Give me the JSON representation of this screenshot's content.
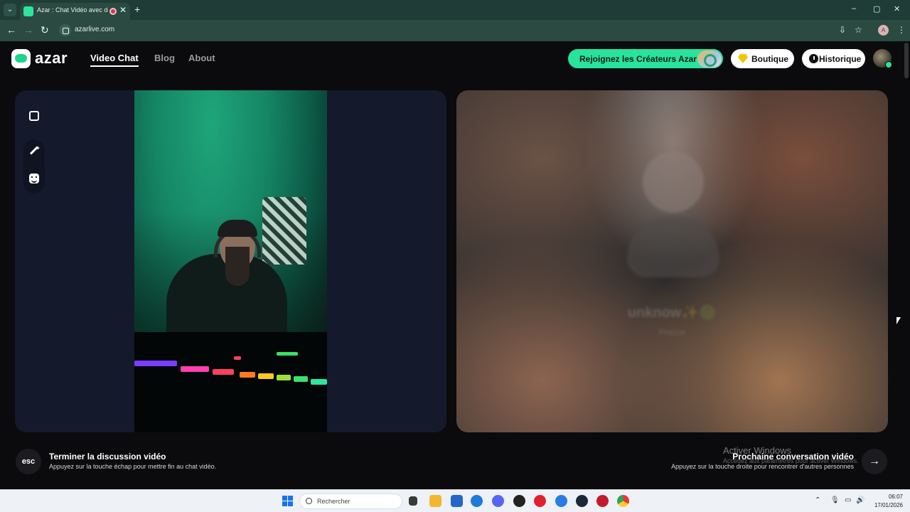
{
  "browser": {
    "tab_title": "Azar : Chat Vidéo avec de n",
    "close_glyph": "✕",
    "new_tab_glyph": "+",
    "url": "azarlive.com",
    "profile_initial": "A",
    "window_controls": [
      "–",
      "▢",
      "✕"
    ],
    "nav_glyphs": {
      "back": "←",
      "forward": "→",
      "reload": "↻"
    },
    "addr_icons": {
      "install": "⇩",
      "star": "☆",
      "menu": "⋮"
    }
  },
  "site": {
    "logo_text": "azar",
    "nav": [
      {
        "label": "Video Chat",
        "active": true
      },
      {
        "label": "Blog",
        "active": false
      },
      {
        "label": "About",
        "active": false
      }
    ],
    "creators_label": "Rejoignez les Créateurs Azar",
    "shop_label": "Boutique",
    "history_label": "Historique",
    "accent_color": "#27e39c"
  },
  "remote": {
    "name": "unknow✨🟢",
    "sub": "France"
  },
  "controls": {
    "esc_label": "esc",
    "end_title": "Terminer la discussion vidéo",
    "end_hint": "Appuyez sur la touche échap pour mettre fin au chat vidéo.",
    "next_title": "Prochaine conversation vidéo",
    "next_hint": "Appuyez sur la touche droite pour rencontrer d'autres personnes",
    "next_glyph": "→"
  },
  "watermark": {
    "title": "Activer Windows",
    "sub": "Accédez aux paramètres pour activer Windows."
  },
  "taskbar": {
    "search_placeholder": "Rechercher",
    "time": "06:07",
    "date": "17/01/2026",
    "tray_icons": [
      "chevron-up-icon",
      "microphone-icon",
      "network-icon",
      "speaker-icon"
    ]
  }
}
